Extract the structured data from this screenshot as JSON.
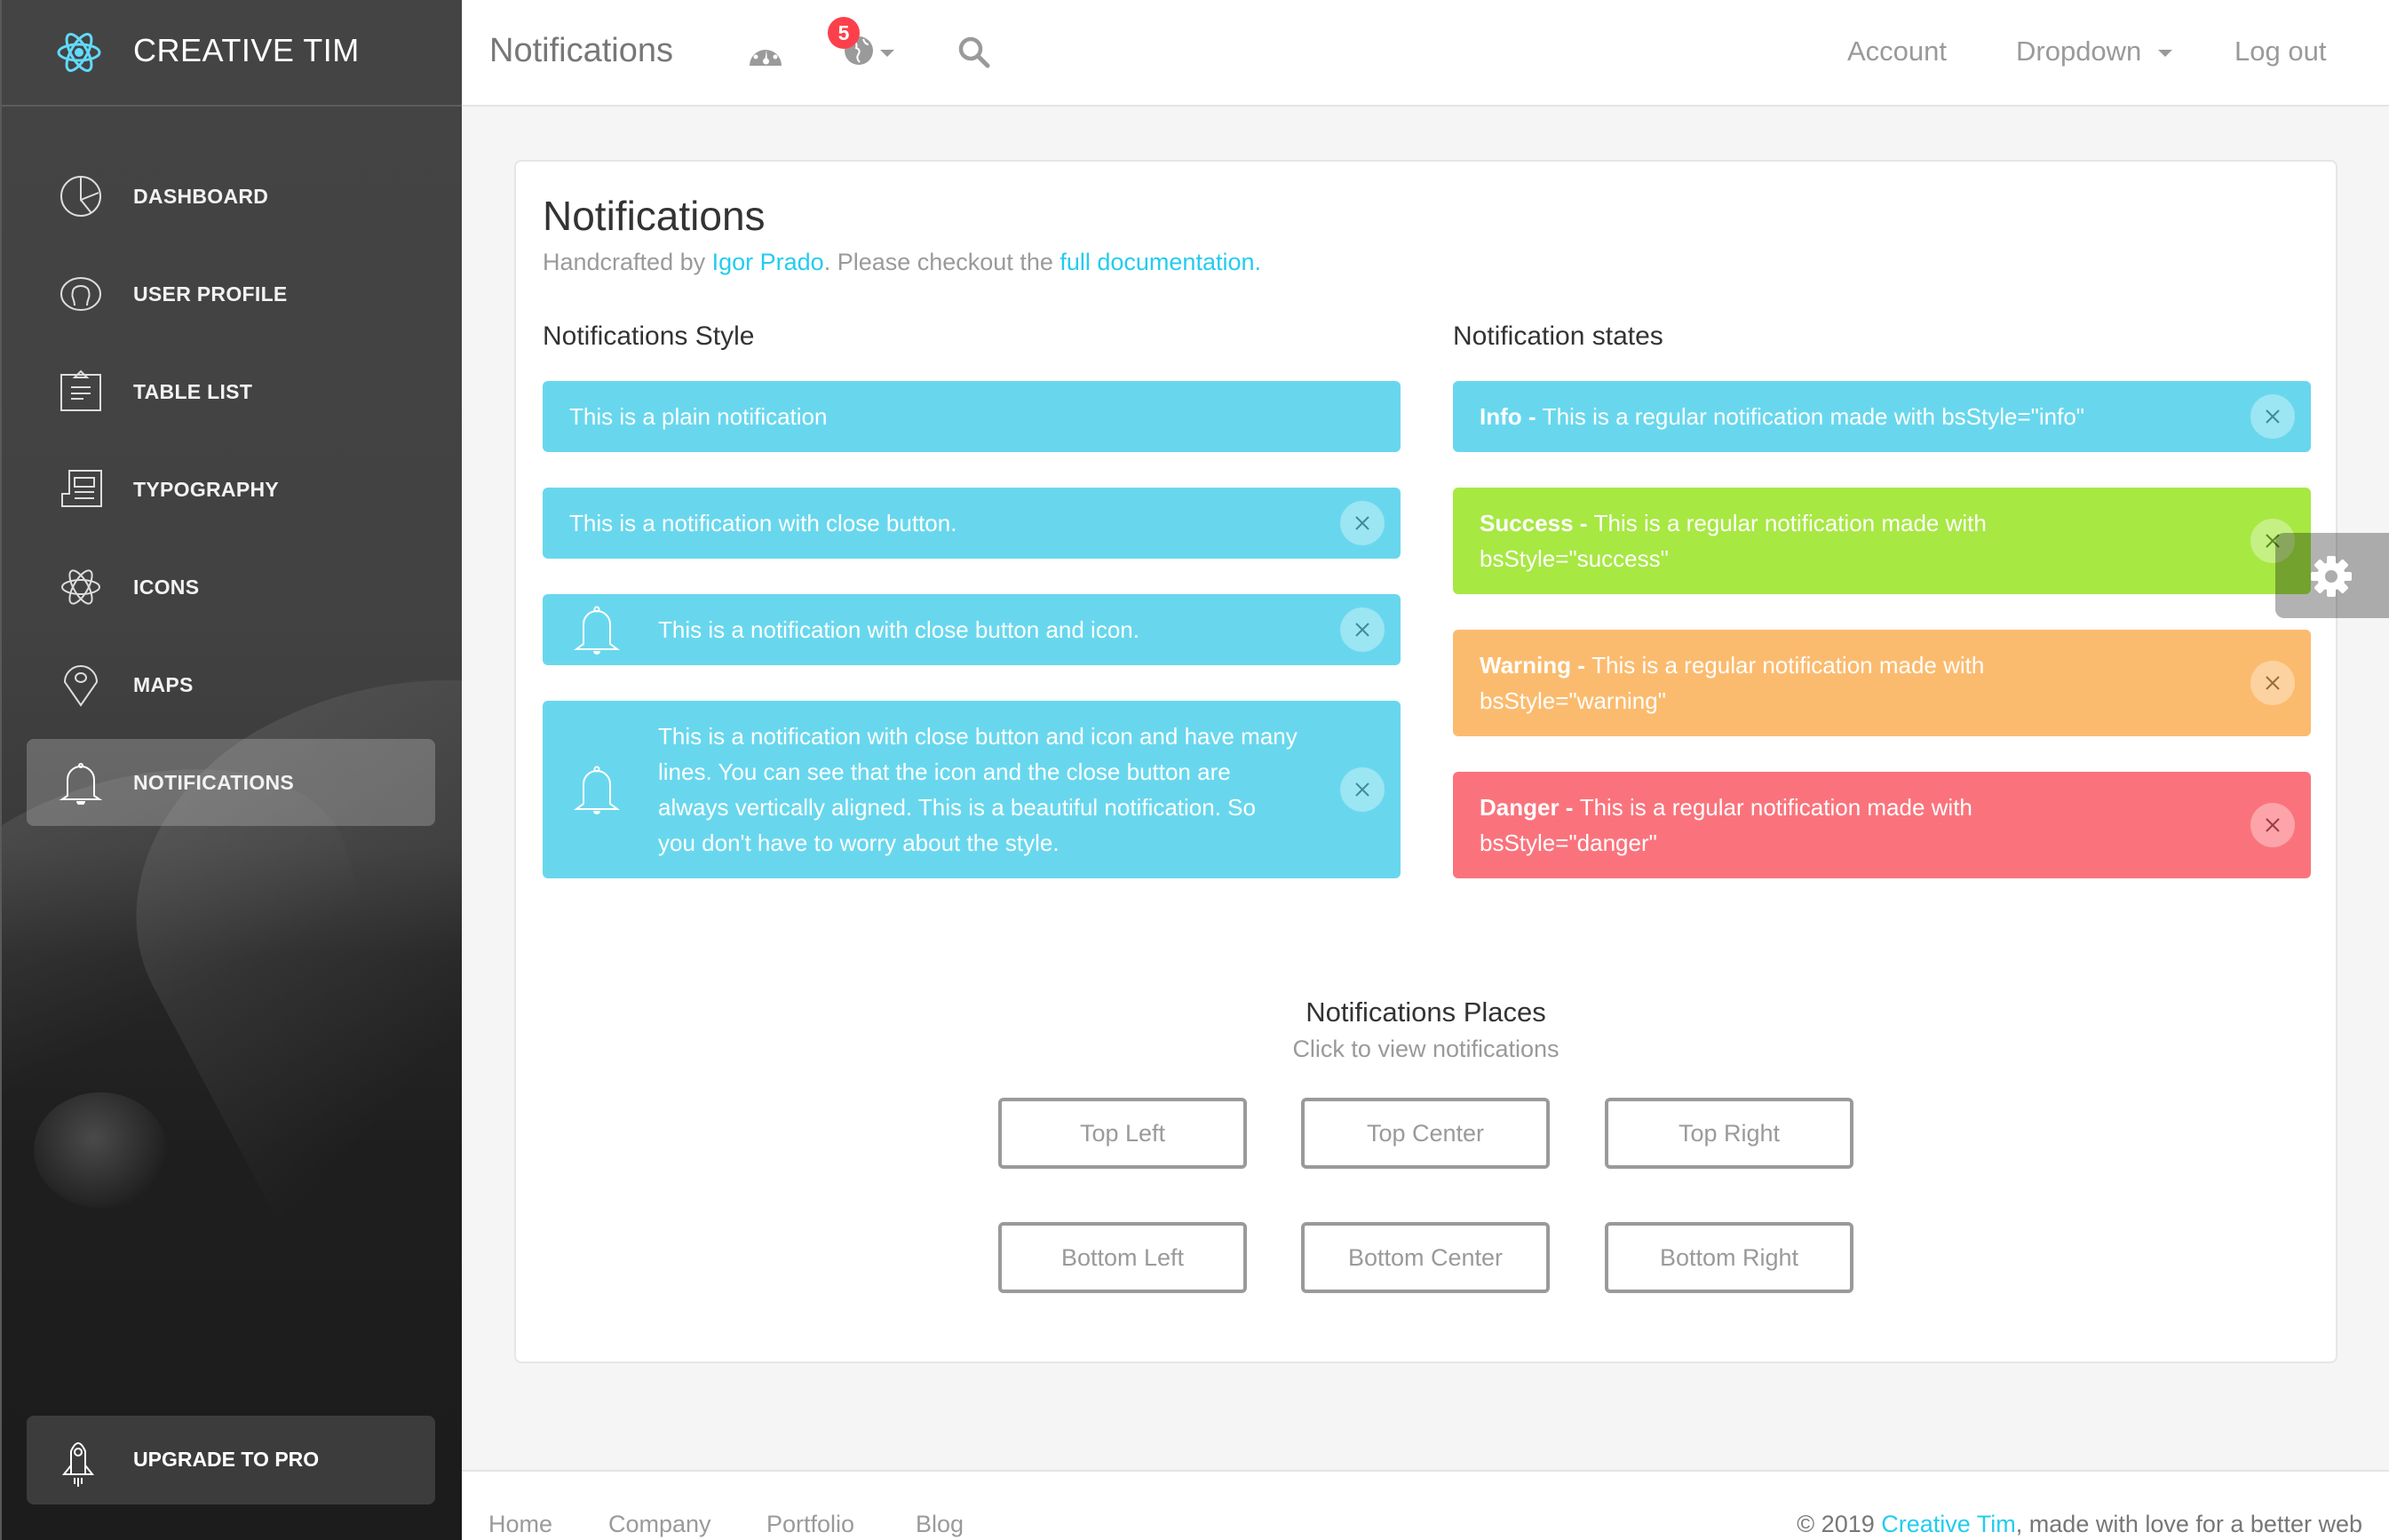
{
  "brand": {
    "name": "CREATIVE TIM",
    "logo_icon": "react-atom-icon",
    "accent": "#61dafb"
  },
  "sidebar": {
    "items": [
      {
        "label": "DASHBOARD",
        "icon": "pie-chart-icon",
        "active": false
      },
      {
        "label": "USER PROFILE",
        "icon": "user-circle-icon",
        "active": false
      },
      {
        "label": "TABLE LIST",
        "icon": "clipboard-icon",
        "active": false
      },
      {
        "label": "TYPOGRAPHY",
        "icon": "newspaper-icon",
        "active": false
      },
      {
        "label": "ICONS",
        "icon": "atom-icon",
        "active": false
      },
      {
        "label": "MAPS",
        "icon": "map-pin-icon",
        "active": false
      },
      {
        "label": "NOTIFICATIONS",
        "icon": "bell-icon",
        "active": true
      }
    ],
    "upgrade": {
      "label": "UPGRADE TO PRO",
      "icon": "rocket-icon"
    }
  },
  "header": {
    "title": "Notifications",
    "icons": [
      "dashboard-gauge-icon",
      "globe-icon",
      "search-icon"
    ],
    "notification_count": "5",
    "links": {
      "account": "Account",
      "dropdown": "Dropdown",
      "logout": "Log out"
    }
  },
  "card": {
    "title": "Notifications",
    "subtitle": {
      "prefix": "Handcrafted by ",
      "author": "Igor Prado",
      "middle": ". Please checkout the ",
      "doc_link": "full documentation."
    },
    "styles_section": {
      "title": "Notifications Style",
      "alerts": [
        {
          "text": "This is a plain notification",
          "close": false,
          "icon": false
        },
        {
          "text": "This is a notification with close button.",
          "close": true,
          "icon": false
        },
        {
          "text": "This is a notification with close button and icon.",
          "close": true,
          "icon": true
        },
        {
          "text": "This is a notification with close button and icon and have many lines. You can see that the icon and the close button are always vertically aligned. This is a beautiful notification. So you don't have to worry about the style.",
          "close": true,
          "icon": true
        }
      ]
    },
    "states_section": {
      "title": "Notification states",
      "alerts": [
        {
          "type": "info",
          "label": "Info - ",
          "text": "This is a regular notification made with bsStyle=\"info\"",
          "color": "#68d7ed"
        },
        {
          "type": "success",
          "label": "Success - ",
          "text": "This is a regular notification made with bsStyle=\"success\"",
          "color": "#a7e843"
        },
        {
          "type": "warning",
          "label": "Warning - ",
          "text": "This is a regular notification made with bsStyle=\"warning\"",
          "color": "#fbbb6e"
        },
        {
          "type": "danger",
          "label": "Danger - ",
          "text": "This is a regular notification made with bsStyle=\"danger\"",
          "color": "#fa737c"
        }
      ]
    },
    "places": {
      "title": "Notifications Places",
      "subtitle": "Click to view notifications",
      "buttons": [
        "Top Left",
        "Top Center",
        "Top Right",
        "Bottom Left",
        "Bottom Center",
        "Bottom Right"
      ]
    }
  },
  "settings": {
    "icon": "gear-icon"
  },
  "footer": {
    "links": [
      "Home",
      "Company",
      "Portfolio",
      "Blog"
    ],
    "copyright": {
      "prefix": "© 2019 ",
      "brand": "Creative Tim",
      "suffix": ", made with love for a better web"
    }
  }
}
